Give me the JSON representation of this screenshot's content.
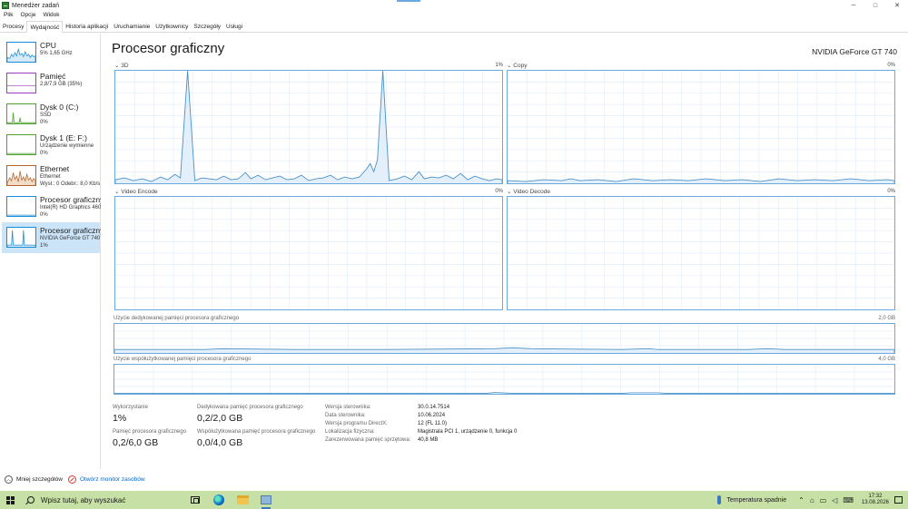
{
  "window": {
    "title": "Menedżer zadań",
    "controls": {
      "minimize": "─",
      "maximize": "□",
      "close": "✕"
    }
  },
  "menu": [
    "Plik",
    "Opcje",
    "Widok"
  ],
  "tabs": [
    {
      "label": "Procesy",
      "active": false
    },
    {
      "label": "Wydajność",
      "active": true
    },
    {
      "label": "Historia aplikacji",
      "active": false
    },
    {
      "label": "Uruchamianie",
      "active": false
    },
    {
      "label": "Użytkownicy",
      "active": false
    },
    {
      "label": "Szczegóły",
      "active": false
    },
    {
      "label": "Usługi",
      "active": false
    }
  ],
  "sidebar": {
    "items": [
      {
        "title": "CPU",
        "line1": "5% 1,65 GHz",
        "line2": "",
        "color": "#1a8bd6",
        "icon": "cpu-graph"
      },
      {
        "title": "Pamięć",
        "line1": "2,8/7,9 GB (35%)",
        "line2": "",
        "color": "#9b3dbb",
        "icon": "memory-graph"
      },
      {
        "title": "Dysk 0 (C:)",
        "line1": "SSD",
        "line2": "0%",
        "color": "#4da032",
        "icon": "disk-graph"
      },
      {
        "title": "Dysk 1 (E: F:)",
        "line1": "Urządzenie wymienne",
        "line2": "0%",
        "color": "#4da032",
        "icon": "disk-graph"
      },
      {
        "title": "Ethernet",
        "line1": "Ethernet",
        "line2": "Wysł.: 0 Odebr.: 8,0 Kb/s",
        "color": "#b2642a",
        "icon": "network-graph"
      },
      {
        "title": "Procesor graficzny 0",
        "line1": "Intel(R) HD Graphics 4600",
        "line2": "0%",
        "color": "#1a8bd6",
        "icon": "gpu-graph"
      },
      {
        "title": "Procesor graficzny 1",
        "line1": "NVIDIA GeForce GT 740",
        "line2": "1%",
        "color": "#1a8bd6",
        "icon": "gpu-graph",
        "selected": true
      }
    ]
  },
  "main": {
    "title": "Procesor graficzny",
    "device": "NVIDIA GeForce GT 740",
    "engines": [
      {
        "name": "3D",
        "value": "1%",
        "utilization": 0.01
      },
      {
        "name": "Copy",
        "value": "0%",
        "utilization": 0.0
      },
      {
        "name": "Video Encode",
        "value": "0%",
        "utilization": 0.0
      },
      {
        "name": "Video Decode",
        "value": "0%",
        "utilization": 0.0
      }
    ],
    "dedicated_memory": {
      "label": "Użycie dedykowanej pamięci procesora graficznego",
      "max": "2,0 GB"
    },
    "shared_memory": {
      "label": "Użycie współużytkowanej pamięci procesora graficznego",
      "max": "4,0 GB"
    },
    "stats": {
      "utilization_label": "Wykorzystanie",
      "utilization_value": "1%",
      "dedicated_label": "Dedykowana pamięć procesora graficznego",
      "dedicated_value": "0,2/2,0 GB",
      "gpu_memory_label": "Pamięć procesora graficznego",
      "gpu_memory_value": "0,2/6,0 GB",
      "shared_label": "Współużytkowana pamięć procesora graficznego",
      "shared_value": "0,0/4,0 GB"
    },
    "info": [
      {
        "key": "Wersja sterownika:",
        "value": "30.0.14.7514"
      },
      {
        "key": "Data sterownika:",
        "value": "10.06.2024"
      },
      {
        "key": "Wersja programu DirectX:",
        "value": "12 (FL 11.0)"
      },
      {
        "key": "Lokalizacja fizyczna:",
        "value": "Magistrala PCI 1, urządzenie 0, funkcja 0"
      },
      {
        "key": "Zarezerwowana pamięć sprzętowa:",
        "value": "40,8 MB"
      }
    ]
  },
  "footer": {
    "fewer_details": "Mniej szczegółów",
    "open_monitor": "Otwórz monitor zasobów"
  },
  "taskbar": {
    "search_placeholder": "Wpisz tutaj, aby wyszukać",
    "weather": "Temperatura spadnie",
    "time": "17:32",
    "date": "13.08.2026"
  },
  "colors": {
    "accent": "#1a8bd6",
    "graph_border": "#6aa8e0",
    "taskbar": "#c7e0a6"
  }
}
